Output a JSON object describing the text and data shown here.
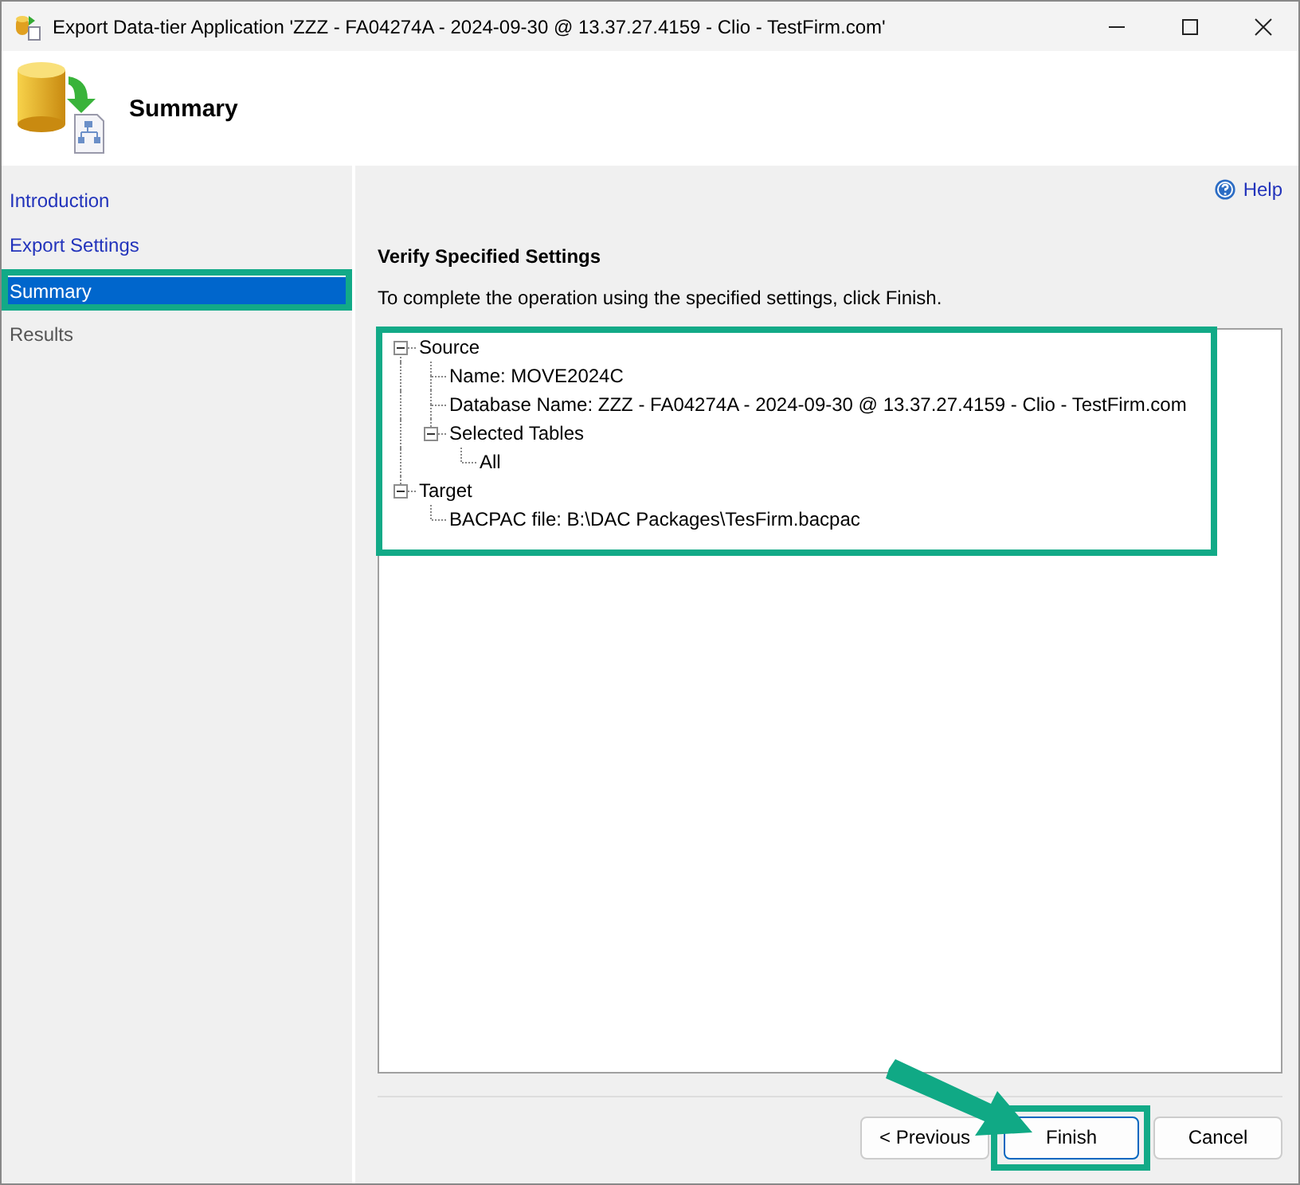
{
  "window": {
    "title": "Export Data-tier Application 'ZZZ - FA04274A - 2024-09-30 @ 13.37.27.4159 - Clio - TestFirm.com'"
  },
  "header": {
    "title": "Summary"
  },
  "sidebar": {
    "items": [
      {
        "label": "Introduction",
        "selected": false,
        "disabled": false,
        "highlighted": false
      },
      {
        "label": "Export Settings",
        "selected": false,
        "disabled": false,
        "highlighted": false
      },
      {
        "label": "Summary",
        "selected": true,
        "disabled": false,
        "highlighted": true
      },
      {
        "label": "Results",
        "selected": false,
        "disabled": true,
        "highlighted": false
      }
    ]
  },
  "help": {
    "label": "Help"
  },
  "section": {
    "title": "Verify Specified Settings",
    "description": "To complete the operation using the specified settings, click Finish."
  },
  "tree": {
    "highlighted": true,
    "items": [
      {
        "label": "Source",
        "expanded": true,
        "children": [
          {
            "label": "Name: MOVE2024C"
          },
          {
            "label": "Database Name: ZZZ - FA04274A - 2024-09-30 @ 13.37.27.4159 - Clio - TestFirm.com"
          },
          {
            "label": "Selected Tables",
            "expanded": true,
            "children": [
              {
                "label": "All"
              }
            ]
          }
        ]
      },
      {
        "label": "Target",
        "expanded": true,
        "children": [
          {
            "label": "BACPAC file: B:\\DAC Packages\\TesFirm.bacpac"
          }
        ]
      }
    ]
  },
  "buttons": [
    {
      "label": "< Previous",
      "default": false,
      "highlighted": false
    },
    {
      "label": "Finish",
      "default": true,
      "highlighted": true
    },
    {
      "label": "Cancel",
      "default": false,
      "highlighted": false
    }
  ],
  "pointer_arrow": true
}
